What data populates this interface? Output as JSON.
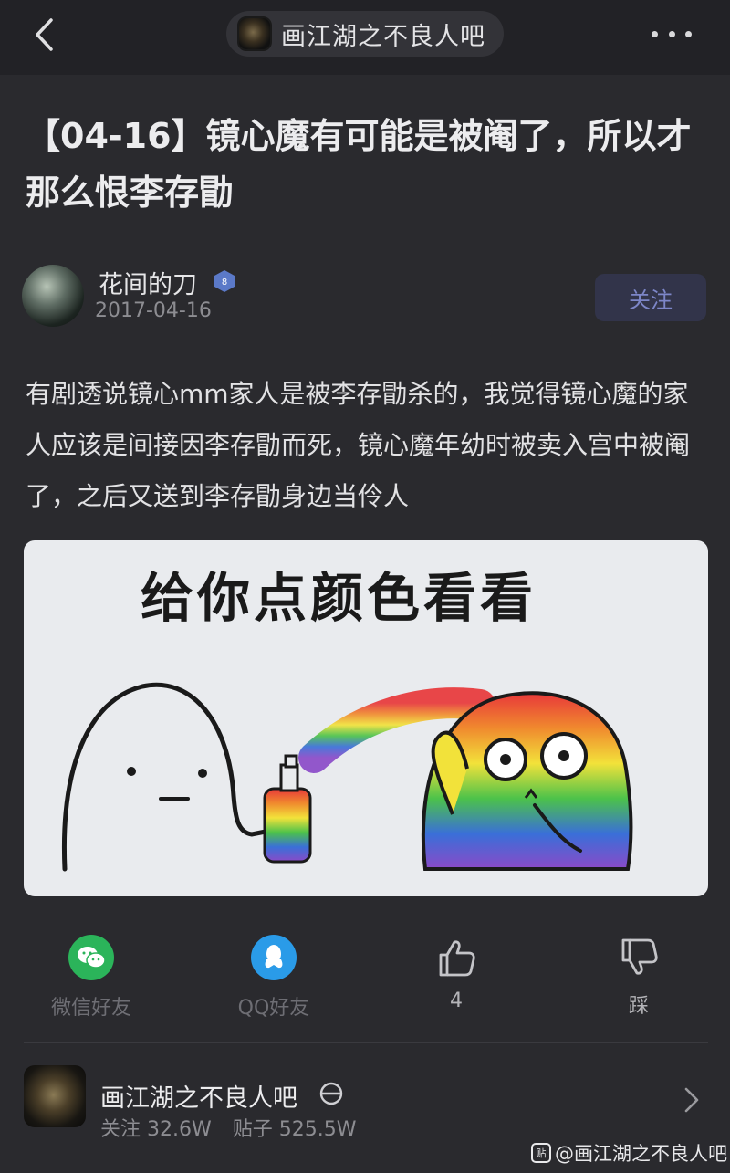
{
  "header": {
    "forum_name": "画江湖之不良人吧",
    "back_icon": "chevron-left-icon",
    "more_icon": "more-horizontal-icon"
  },
  "post": {
    "title": "【04-16】镜心魔有可能是被阉了，所以才那么恨李存勖",
    "author": {
      "name": "花间的刀",
      "level": "8",
      "date": "2017-04-16",
      "follow_label": "关注"
    },
    "body": "有剧透说镜心mm家人是被李存勖杀的，我觉得镜心魔的家人应该是间接因李存勖而死，镜心魔年幼时被卖入宫中被阉了，之后又送到李存勖身边当伶人",
    "image": {
      "caption": "给你点颜色看看"
    }
  },
  "actions": {
    "wechat_label": "微信好友",
    "qq_label": "QQ好友",
    "like_count": "4",
    "dislike_label": "踩"
  },
  "forum_card": {
    "name": "画江湖之不良人吧",
    "followers": "关注 32.6W",
    "posts": "贴子 525.5W"
  },
  "watermark": {
    "logo": "贴",
    "text": "@画江湖之不良人吧"
  },
  "colors": {
    "background": "#2a2a2e",
    "topbar": "#222226",
    "follow_text": "#7d86c8",
    "wechat_green": "#2bb45a",
    "qq_blue": "#2a9be8"
  }
}
